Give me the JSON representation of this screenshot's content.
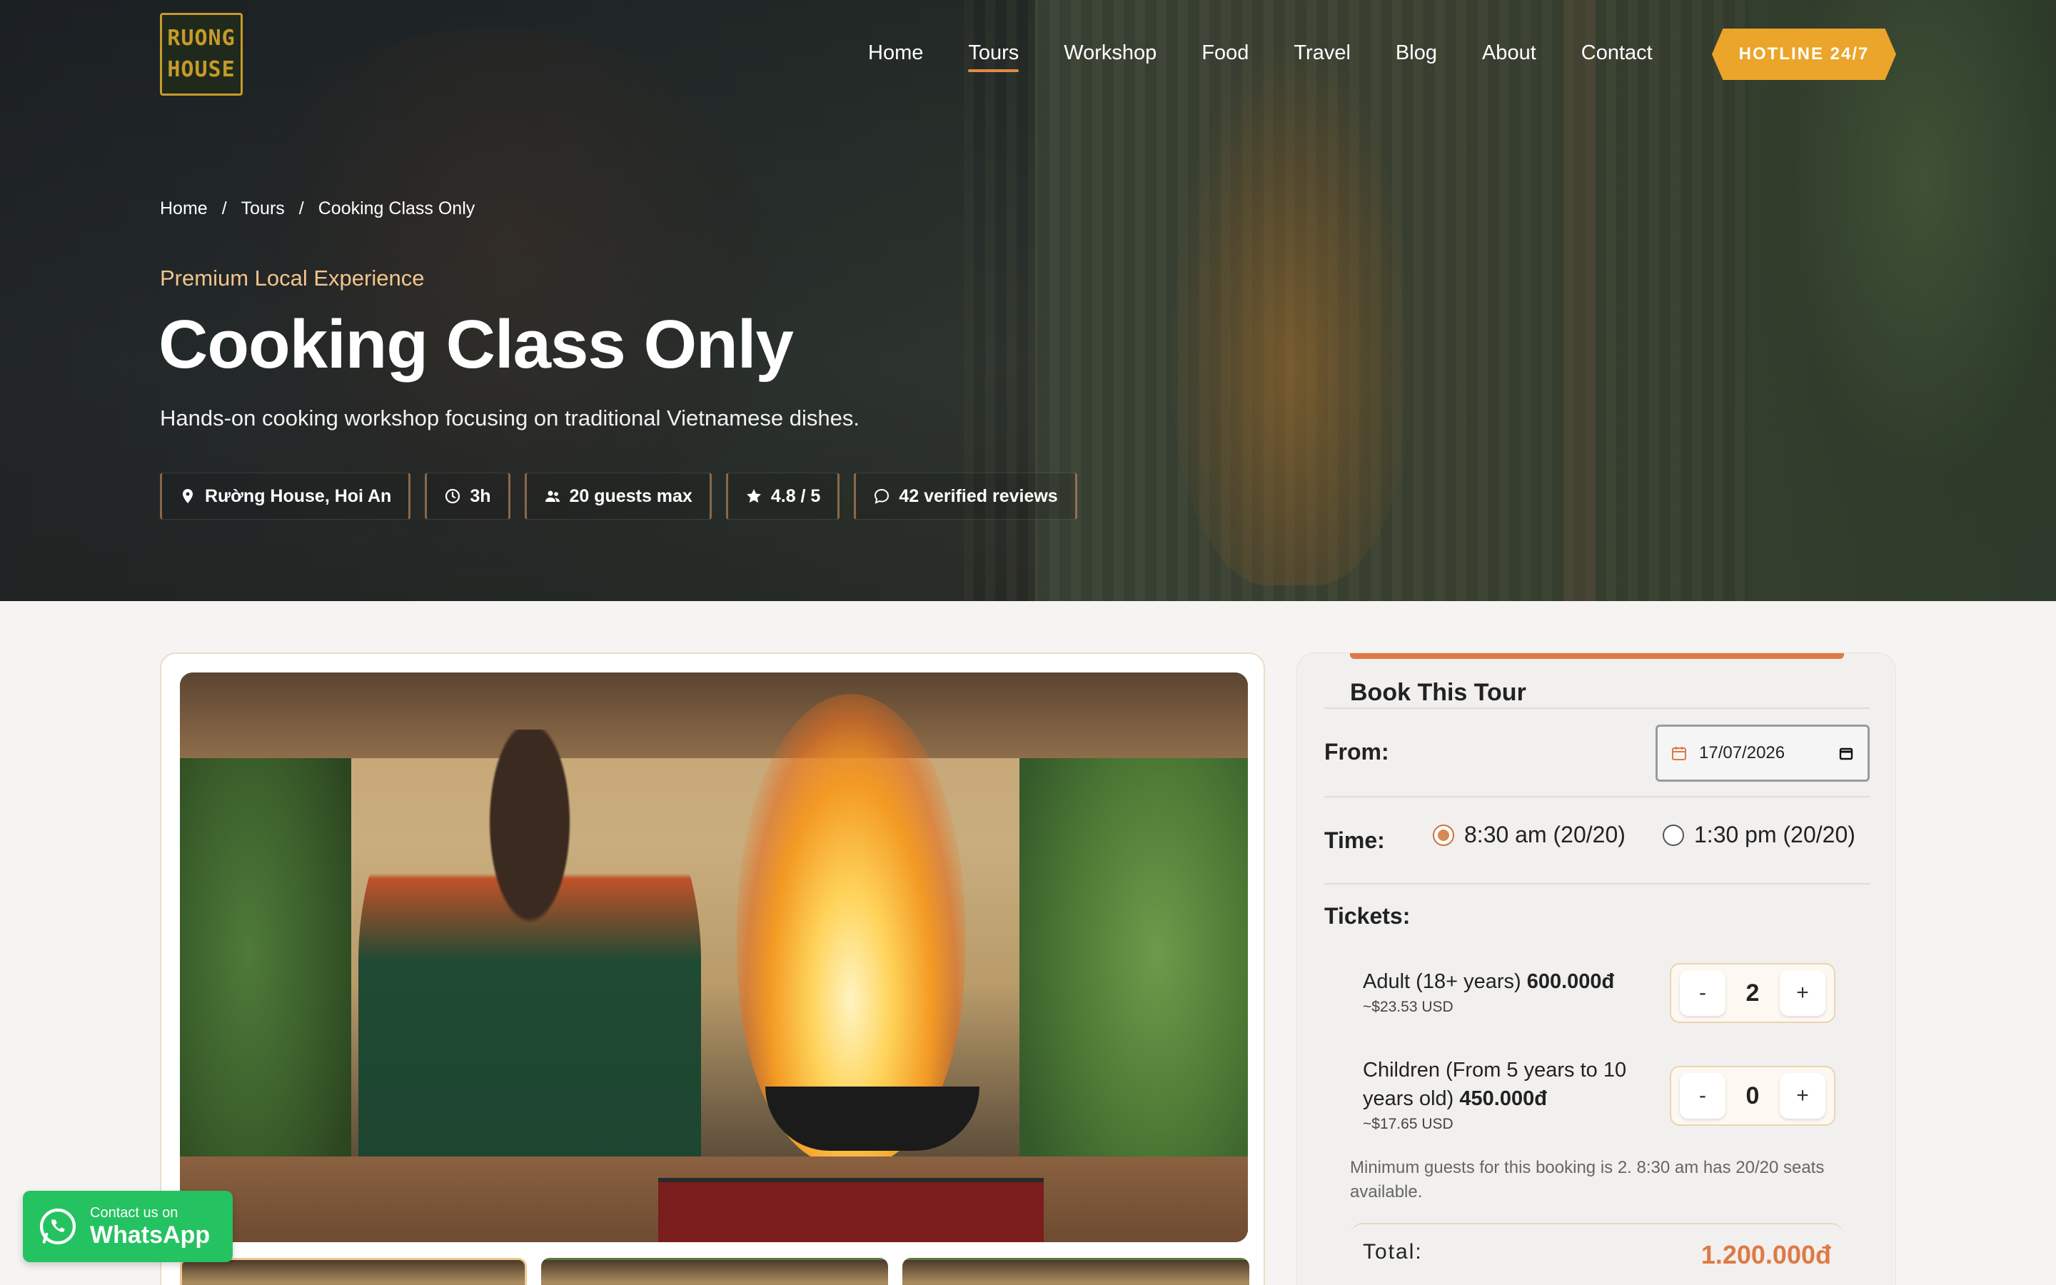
{
  "logo": {
    "line1": "RUONG",
    "line2": "HOUSE"
  },
  "nav": {
    "items": [
      "Home",
      "Tours",
      "Workshop",
      "Food",
      "Travel",
      "Blog",
      "About",
      "Contact"
    ],
    "active": "Tours",
    "hotline": "HOTLINE 24/7"
  },
  "breadcrumb": {
    "items": [
      "Home",
      "Tours",
      "Cooking Class Only"
    ],
    "separator": "/"
  },
  "hero": {
    "kicker": "Premium Local Experience",
    "title": "Cooking Class Only",
    "subtitle": "Hands-on cooking workshop focusing on traditional Vietnamese dishes.",
    "chips": [
      {
        "icon": "map-pin-icon",
        "label": "Rường House, Hoi An"
      },
      {
        "icon": "clock-icon",
        "label": "3h"
      },
      {
        "icon": "users-icon",
        "label": "20 guests max"
      },
      {
        "icon": "star-icon",
        "label": "4.8 / 5"
      },
      {
        "icon": "chat-bubble-icon",
        "label": "42 verified reviews"
      }
    ]
  },
  "gallery": {
    "thumb_count": 3,
    "active_thumb": 0
  },
  "booking": {
    "title": "Book This Tour",
    "from_label": "From:",
    "date_value": "17/07/2026",
    "time_label": "Time:",
    "time_options": [
      {
        "label": "8:30 am (20/20)",
        "selected": true
      },
      {
        "label": "1:30 pm (20/20)",
        "selected": false
      }
    ],
    "tickets_label": "Tickets:",
    "tickets": [
      {
        "name": "Adult (18+ years)",
        "price": "600.000đ",
        "usd": "~$23.53 USD",
        "qty": "2"
      },
      {
        "name_line1": "Children (From 5 years to 10",
        "name_line2": "years old)",
        "price": "450.000đ",
        "usd": "~$17.65 USD",
        "qty": "0"
      }
    ],
    "minus": "-",
    "plus": "+",
    "note": "Minimum guests for this booking is 2. 8:30 am has 20/20 seats available.",
    "total_label": "Total:",
    "total_value": "1.200.000đ"
  },
  "whatsapp": {
    "small": "Contact us on",
    "big": "WhatsApp"
  },
  "colors": {
    "accent_orange": "#de7a45",
    "hotline_bg": "#eba52a",
    "whatsapp_green": "#25c261",
    "kicker": "#f1c58e"
  }
}
